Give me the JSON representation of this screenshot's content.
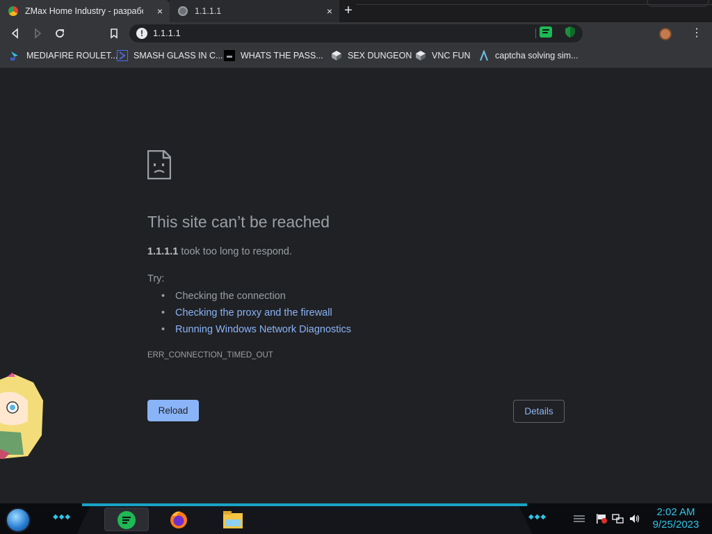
{
  "tabs": [
    {
      "title": "ZMax Home Industry - разработк",
      "close": "×",
      "favicon": "chrome-icon",
      "active": true
    },
    {
      "title": "1.1.1.1",
      "close": "×",
      "favicon": "globe-icon",
      "active": false
    }
  ],
  "new_tab": "+",
  "toolbar": {
    "url": "1.1.1.1",
    "warn": "!",
    "menu": "⋮"
  },
  "bookmarks": [
    {
      "label": "MEDIAFIRE ROULET...",
      "icon": "mediafire-icon"
    },
    {
      "label": "SMASH GLASS IN C...",
      "icon": "arrow-icon"
    },
    {
      "label": "WHATS THE PASS...",
      "icon": "screen-icon"
    },
    {
      "label": "SEX DUNGEON",
      "icon": "cube-icon"
    },
    {
      "label": "VNC FUN",
      "icon": "cube-icon"
    },
    {
      "label": "captcha solving sim...",
      "icon": "lambda-icon"
    }
  ],
  "error": {
    "title": "This site can’t be reached",
    "host": "1.1.1.1",
    "message": " took too long to respond.",
    "try": "Try:",
    "suggestions": [
      {
        "text": "Checking the connection",
        "link": false
      },
      {
        "text": "Checking the proxy and the firewall",
        "link": true
      },
      {
        "text": "Running Windows Network Diagnostics",
        "link": true
      }
    ],
    "code": "ERR_CONNECTION_TIMED_OUT",
    "reload": "Reload",
    "details": "Details"
  },
  "taskbar": {
    "time": "2:02 AM",
    "date": "9/25/2023"
  },
  "colors": {
    "accent": "#8ab4f8",
    "background": "#202124",
    "taskbar_accent": "#2ec5e8"
  }
}
